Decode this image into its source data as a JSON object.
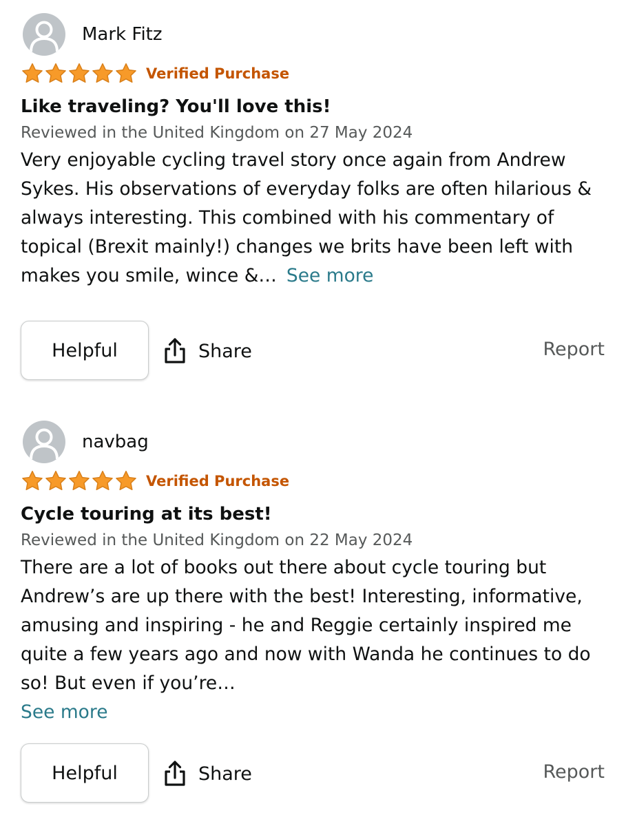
{
  "colors": {
    "star": "#f79a29",
    "verified": "#c45500",
    "link": "#2a7a8a",
    "muted": "#565959",
    "avatar_bg": "#bfc4c8"
  },
  "icons": {
    "avatar": "person-silhouette-icon",
    "star": "star-icon",
    "share": "share-arrow-icon"
  },
  "reviews": [
    {
      "reviewer": "Mark Fitz",
      "rating": 5,
      "rating_max": 5,
      "badge": "Verified Purchase",
      "title": "Like traveling? You'll love this!",
      "date_line": "Reviewed in the United Kingdom on 27 May 2024",
      "body": "Very enjoyable cycling travel story once again from Andrew Sykes. His observations of everyday folks are often hilarious & always interesting. This combined with his commentary of topical (Brexit mainly!) changes we brits have been left with makes you smile, wince &…",
      "see_more": "See more",
      "helpful_label": "Helpful",
      "share_label": "Share",
      "report_label": "Report"
    },
    {
      "reviewer": "navbag",
      "rating": 5,
      "rating_max": 5,
      "badge": "Verified Purchase",
      "title": "Cycle touring at its best!",
      "date_line": "Reviewed in the United Kingdom on 22 May 2024",
      "body": "There are a lot of books out there about cycle touring but Andrew’s are up there with the best! Interesting, informative, amusing and inspiring - he and Reggie certainly inspired me quite a few years ago and now with Wanda he continues to do so! But even if you’re…",
      "see_more": "See more",
      "helpful_label": "Helpful",
      "share_label": "Share",
      "report_label": "Report"
    }
  ]
}
